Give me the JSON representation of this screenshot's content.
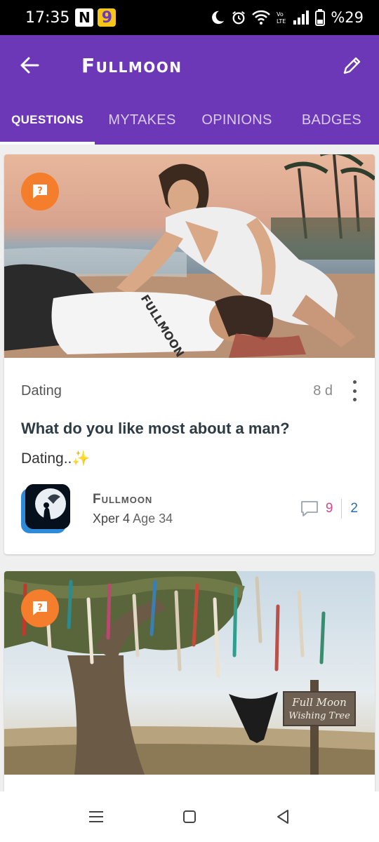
{
  "status_bar": {
    "time": "17:35",
    "notification_n": "N",
    "notification_g": "9",
    "battery": "%29"
  },
  "app_bar": {
    "title": "Fullmoon"
  },
  "tabs": [
    {
      "label": "QUESTIONS",
      "active": true
    },
    {
      "label": "MYTAKES",
      "active": false
    },
    {
      "label": "OPINIONS",
      "active": false
    },
    {
      "label": "BADGES",
      "active": false
    }
  ],
  "posts": [
    {
      "category": "Dating",
      "time": "8 d",
      "title": "What do you like most about a man?",
      "description": "Dating..✨",
      "author": {
        "name": "Fullmoon",
        "xper": "Xper 4",
        "age": "Age 34"
      },
      "opinions_count": "9",
      "second_count": "2",
      "image_shirt_text": "FULLMOON"
    },
    {
      "sign_line1": "Full Moon",
      "sign_line2": "Wishing Tree"
    }
  ],
  "colors": {
    "brand_purple": "#6c38b8",
    "question_badge": "#f47e2b",
    "pink_count": "#d04b8f",
    "blue_count": "#2b6db1"
  }
}
